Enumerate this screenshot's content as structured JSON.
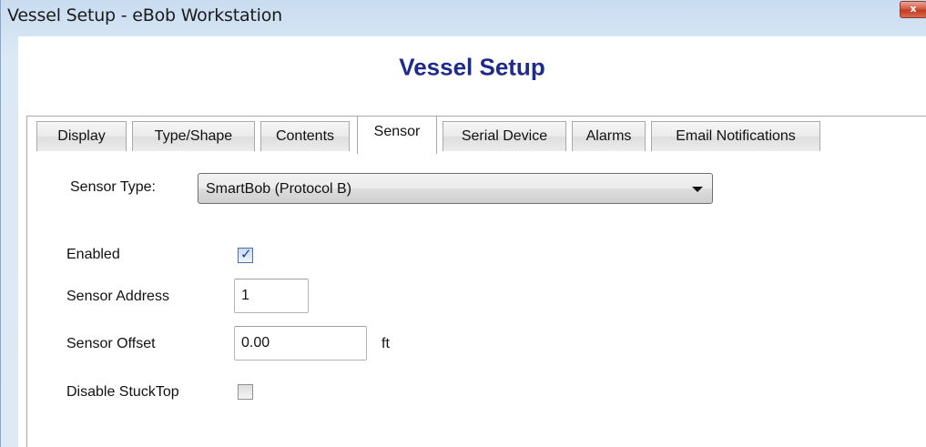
{
  "window": {
    "title": "Vessel Setup - eBob Workstation",
    "close_glyph": "x"
  },
  "heading": "Vessel Setup",
  "tabs": [
    {
      "label": "Display",
      "active": false
    },
    {
      "label": "Type/Shape",
      "active": false
    },
    {
      "label": "Contents",
      "active": false
    },
    {
      "label": "Sensor",
      "active": true
    },
    {
      "label": "Serial Device",
      "active": false
    },
    {
      "label": "Alarms",
      "active": false
    },
    {
      "label": "Email Notifications",
      "active": false
    }
  ],
  "sensor": {
    "type_label": "Sensor Type:",
    "type_value": "SmartBob (Protocol B)",
    "enabled_label": "Enabled",
    "enabled_checked": true,
    "address_label": "Sensor Address",
    "address_value": "1",
    "offset_label": "Sensor Offset",
    "offset_value": "0.00",
    "offset_unit": "ft",
    "disable_stucktop_label": "Disable StuckTop",
    "disable_stucktop_checked": false
  },
  "colors": {
    "heading": "#1e2a8c",
    "title_bar": "#c9dcf0",
    "close_button": "#c23a22"
  },
  "icons": {
    "close": "close-icon",
    "dropdown": "chevron-down-icon",
    "check": "checkmark-icon"
  }
}
